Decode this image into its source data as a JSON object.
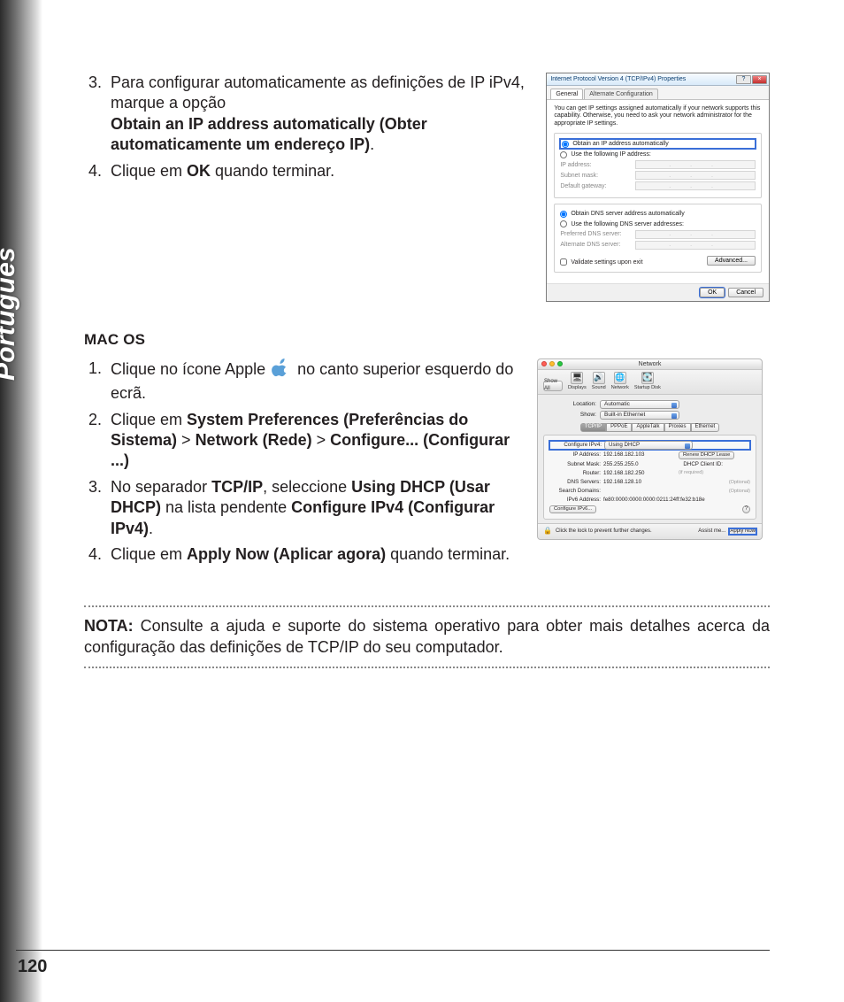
{
  "side_label": "Português",
  "page_number": "120",
  "win_list": {
    "item3": {
      "num": "3.",
      "pre": "Para configurar automaticamente as definições de IP iPv4, marque a opção ",
      "bold": "Obtain an IP address automatically (Obter automaticamente um endereço IP)",
      "post": "."
    },
    "item4": {
      "num": "4.",
      "pre": "Clique em ",
      "bold": "OK",
      "post": " quando terminar."
    }
  },
  "mac_heading": "MAC OS",
  "mac_list": {
    "item1": {
      "num": "1.",
      "pre": "Clique no ícone Apple ",
      "post": " no canto superior esquerdo do ecrã."
    },
    "item2": {
      "num": "2.",
      "a": "Clique em ",
      "b": "System Preferences (Preferências do Sistema)",
      "c": " > ",
      "d": "Network (Rede)",
      "e": " > ",
      "f": "Configure... (Configurar ...)"
    },
    "item3": {
      "num": "3.",
      "a": "No separador ",
      "b": "TCP/IP",
      "c": ", seleccione ",
      "d": "Using DHCP (Usar DHCP)",
      "e": " na lista pendente ",
      "f": "Configure IPv4 (Configurar IPv4)",
      "g": "."
    },
    "item4": {
      "num": "4.",
      "a": "Clique em ",
      "b": "Apply Now (Aplicar agora)",
      "c": " quando terminar."
    }
  },
  "note": {
    "label": "NOTA:",
    "text": " Consulte a ajuda e suporte do sistema operativo para obter mais detalhes acerca da configuração das definições de TCP/IP do seu computador."
  },
  "windlg": {
    "title": "Internet Protocol Version 4 (TCP/IPv4) Properties",
    "tab1": "General",
    "tab2": "Alternate Configuration",
    "hint": "You can get IP settings assigned automatically if your network supports this capability. Otherwise, you need to ask your network administrator for the appropriate IP settings.",
    "r1": "Obtain an IP address automatically",
    "r2": "Use the following IP address:",
    "ip": "IP address:",
    "subnet": "Subnet mask:",
    "gw": "Default gateway:",
    "r3": "Obtain DNS server address automatically",
    "r4": "Use the following DNS server addresses:",
    "pdns": "Preferred DNS server:",
    "adns": "Alternate DNS server:",
    "validate": "Validate settings upon exit",
    "advanced": "Advanced...",
    "ok": "OK",
    "cancel": "Cancel"
  },
  "macdlg": {
    "title": "Network",
    "tb_showall": "Show All",
    "tb_displays": "Displays",
    "tb_sound": "Sound",
    "tb_network": "Network",
    "tb_startup": "Startup Disk",
    "loc_label": "Location:",
    "loc_val": "Automatic",
    "show_label": "Show:",
    "show_val": "Built-in Ethernet",
    "tabs": [
      "TCP/IP",
      "PPPoE",
      "AppleTalk",
      "Proxies",
      "Ethernet"
    ],
    "cfg_label": "Configure IPv4:",
    "cfg_val": "Using DHCP",
    "ip_label": "IP Address:",
    "ip_val": "192.168.182.103",
    "renew": "Renew DHCP Lease",
    "sn_label": "Subnet Mask:",
    "sn_val": "255.255.255.0",
    "client_label": "DHCP Client ID:",
    "client_hint": "(if required)",
    "router_label": "Router:",
    "router_val": "192.168.182.250",
    "dns_label": "DNS Servers:",
    "dns_val": "192.168.128.10",
    "optional": "(Optional)",
    "sd_label": "Search Domains:",
    "ipv6_label": "IPv6 Address:",
    "ipv6_val": "fe80:0000:0000:0000:0211:24ff:fe32:b18e",
    "cfg6": "Configure IPv6...",
    "lock": "Click the lock to prevent further changes.",
    "assist": "Assist me...",
    "apply": "Apply Now"
  }
}
